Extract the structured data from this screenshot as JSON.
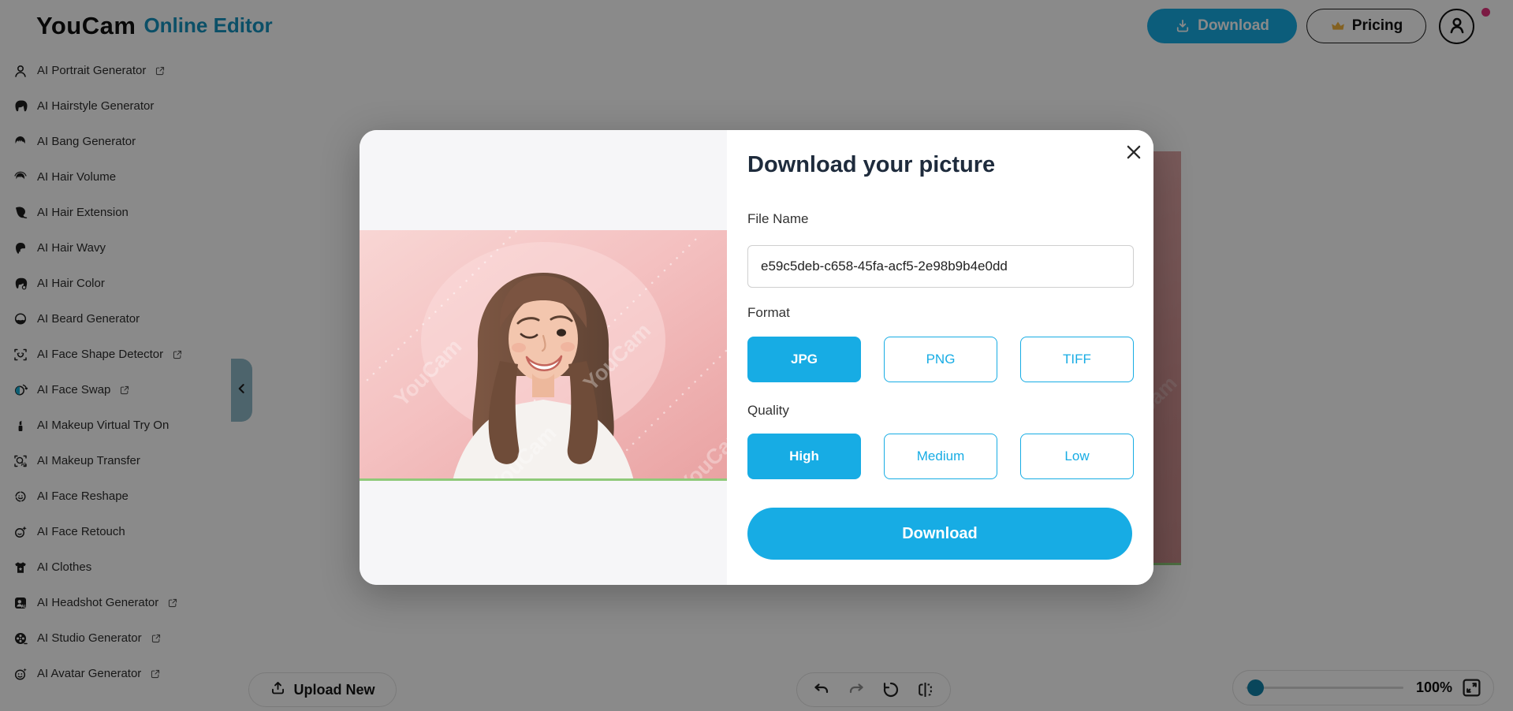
{
  "header": {
    "logo_main": "YouCam",
    "logo_sub": "Online Editor",
    "download_label": "Download",
    "pricing_label": "Pricing"
  },
  "sidebar": {
    "items": [
      {
        "label": "AI Portrait Generator",
        "icon": "portrait-icon",
        "external": true
      },
      {
        "label": "AI Hairstyle Generator",
        "icon": "hairstyle-icon",
        "external": false
      },
      {
        "label": "AI Bang Generator",
        "icon": "bang-icon",
        "external": false
      },
      {
        "label": "AI Hair Volume",
        "icon": "hair-volume-icon",
        "external": false
      },
      {
        "label": "AI Hair Extension",
        "icon": "hair-extension-icon",
        "external": false
      },
      {
        "label": "AI Hair Wavy",
        "icon": "hair-wavy-icon",
        "external": false
      },
      {
        "label": "AI Hair Color",
        "icon": "hair-color-icon",
        "external": false
      },
      {
        "label": "AI Beard Generator",
        "icon": "beard-icon",
        "external": false
      },
      {
        "label": "AI Face Shape Detector",
        "icon": "face-shape-icon",
        "external": true
      },
      {
        "label": "AI Face Swap",
        "icon": "face-swap-icon",
        "external": true
      },
      {
        "label": "AI Makeup Virtual Try On",
        "icon": "lipstick-icon",
        "external": false
      },
      {
        "label": "AI Makeup Transfer",
        "icon": "makeup-transfer-icon",
        "external": false
      },
      {
        "label": "AI Face Reshape",
        "icon": "face-reshape-icon",
        "external": false
      },
      {
        "label": "AI Face Retouch",
        "icon": "face-retouch-icon",
        "external": false
      },
      {
        "label": "AI Clothes",
        "icon": "clothes-icon",
        "external": false
      },
      {
        "label": "AI Headshot Generator",
        "icon": "headshot-icon",
        "external": true
      },
      {
        "label": "AI Studio Generator",
        "icon": "studio-icon",
        "external": true
      },
      {
        "label": "AI Avatar Generator",
        "icon": "avatar-gen-icon",
        "external": true
      }
    ]
  },
  "modal": {
    "title": "Download your picture",
    "file_name_label": "File Name",
    "file_name_value": "e59c5deb-c658-45fa-acf5-2e98b9b4e0dd",
    "format_label": "Format",
    "format_options": [
      "JPG",
      "PNG",
      "TIFF"
    ],
    "format_selected": "JPG",
    "quality_label": "Quality",
    "quality_options": [
      "High",
      "Medium",
      "Low"
    ],
    "quality_selected": "High",
    "download_label": "Download",
    "watermark": "YouCam"
  },
  "toolbar": {
    "upload_label": "Upload New",
    "zoom_value": "100%"
  },
  "colors": {
    "accent": "#17ACE4",
    "logo_accent": "#1593BE",
    "notification_dot": "#E3317D",
    "crown_gold": "#F2B33D",
    "preview_green_line": "#8FC979"
  }
}
